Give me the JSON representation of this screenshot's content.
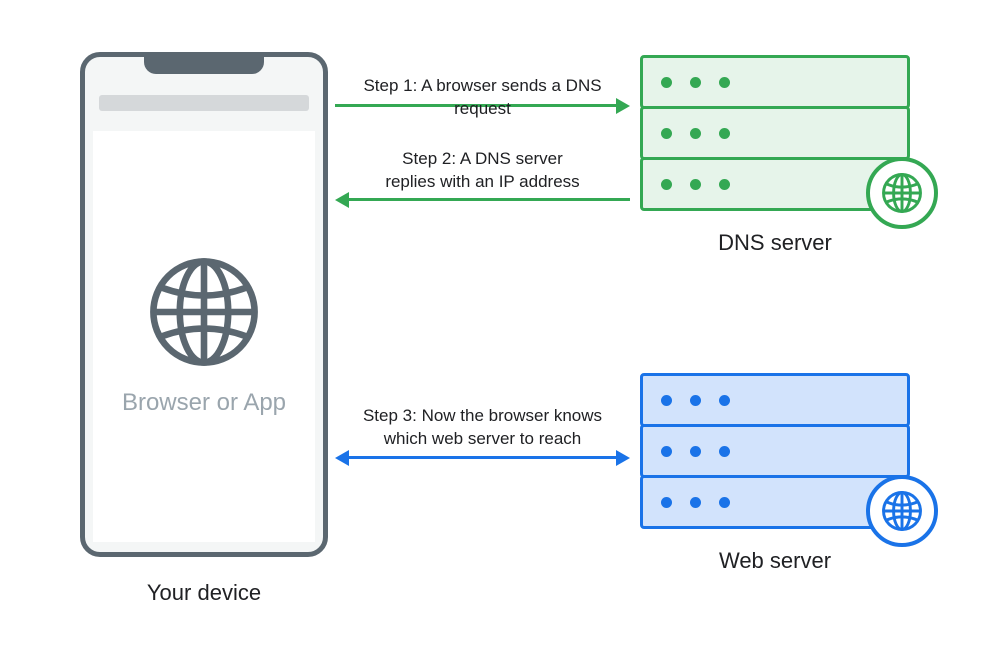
{
  "device": {
    "app_label": "Browser or App",
    "caption": "Your device"
  },
  "dns": {
    "caption": "DNS server"
  },
  "web": {
    "caption": "Web server"
  },
  "steps": {
    "s1": "Step 1: A browser sends a DNS request",
    "s2": "Step 2: A DNS server\nreplies with an IP address",
    "s3": "Step 3: Now the browser knows\nwhich web server to reach"
  },
  "colors": {
    "green": "#34a853",
    "blue": "#1a73e8",
    "device_gray": "#5b6770"
  }
}
